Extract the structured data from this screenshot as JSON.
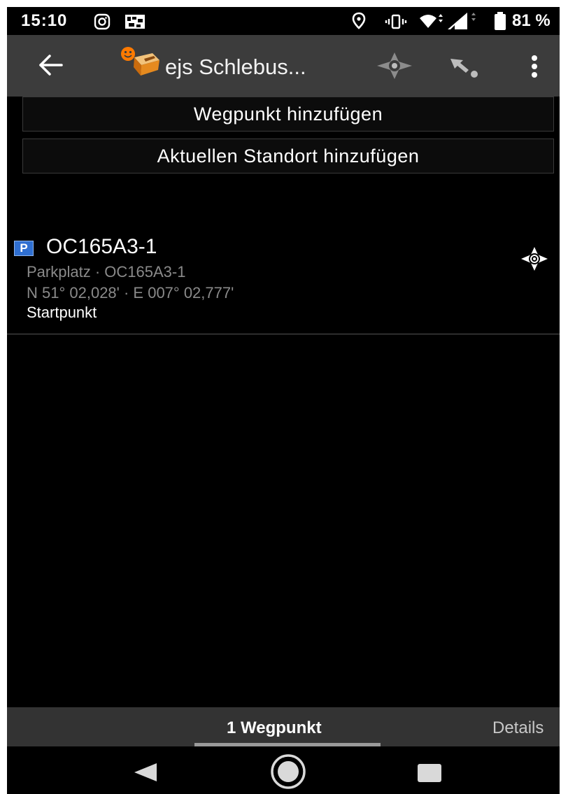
{
  "status_bar": {
    "time": "15:10",
    "battery_percent": "81 %",
    "icons": [
      "instagram-icon",
      "gallery-icon",
      "location-icon",
      "vibrate-icon",
      "wifi-icon",
      "signal-icon",
      "battery-icon"
    ]
  },
  "app_bar": {
    "title": "ejs Schlebus...",
    "icons": [
      "back-arrow-icon",
      "geocache-logo-icon",
      "compass-icon",
      "navigate-icon",
      "more-vert-icon"
    ]
  },
  "actions": {
    "add_waypoint": "Wegpunkt hinzufügen",
    "add_current_location": "Aktuellen Standort hinzufügen"
  },
  "waypoints": [
    {
      "type_badge": "P",
      "name": "OC165A3-1",
      "type_line": "Parkplatz · OC165A3-1",
      "coordinates": "N 51° 02,028' · E 007° 02,777'",
      "note": "Startpunkt"
    }
  ],
  "tabs": [
    {
      "label": "1 Wegpunkt",
      "active": true
    },
    {
      "label": "Details",
      "active": false
    }
  ],
  "colors": {
    "background": "#000000",
    "app_bar": "#3c3c3c",
    "tab_bar": "#333333",
    "type_badge": "#2f6fd1",
    "secondary_text": "#8a8a8a"
  }
}
